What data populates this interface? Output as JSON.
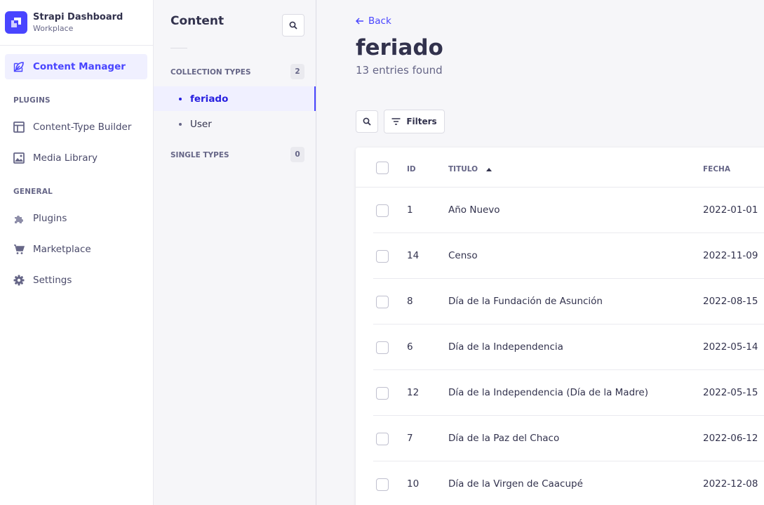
{
  "brand": {
    "name": "Strapi Dashboard",
    "workspace": "Workplace",
    "color": "#4945ff"
  },
  "mainnav": {
    "active": {
      "label": "Content Manager",
      "icon": "feather-icon"
    },
    "sections": [
      {
        "label": "PLUGINS",
        "items": [
          {
            "label": "Content-Type Builder",
            "icon": "layout-icon"
          },
          {
            "label": "Media Library",
            "icon": "image-icon"
          }
        ]
      },
      {
        "label": "GENERAL",
        "items": [
          {
            "label": "Plugins",
            "icon": "puzzle-icon"
          },
          {
            "label": "Marketplace",
            "icon": "cart-icon"
          },
          {
            "label": "Settings",
            "icon": "gear-icon"
          }
        ]
      }
    ]
  },
  "subnav": {
    "title": "Content",
    "collection_label": "COLLECTION TYPES",
    "collection_count": "2",
    "collection_items": [
      "feriado",
      "User"
    ],
    "single_label": "SINGLE TYPES",
    "single_count": "0"
  },
  "main": {
    "back_label": "Back",
    "title": "feriado",
    "subtitle": "13 entries found",
    "filters_label": "Filters"
  },
  "table": {
    "columns": {
      "id": "ID",
      "titulo": "TITULO",
      "fecha": "FECHA"
    },
    "rows": [
      {
        "id": "1",
        "titulo": "Año Nuevo",
        "fecha": "2022-01-01"
      },
      {
        "id": "14",
        "titulo": "Censo",
        "fecha": "2022-11-09"
      },
      {
        "id": "8",
        "titulo": "Día de la Fundación de Asunción",
        "fecha": "2022-08-15"
      },
      {
        "id": "6",
        "titulo": "Día de la Independencia",
        "fecha": "2022-05-14"
      },
      {
        "id": "12",
        "titulo": "Día de la Independencia (Día de la Madre)",
        "fecha": "2022-05-15"
      },
      {
        "id": "7",
        "titulo": "Día de la Paz del Chaco",
        "fecha": "2022-06-12"
      },
      {
        "id": "10",
        "titulo": "Día de la Virgen de Caacupé",
        "fecha": "2022-12-08"
      }
    ]
  },
  "colors": {
    "accent": "#4945ff",
    "active_bg": "#f0f0ff",
    "text": "#32324d",
    "muted": "#666687"
  }
}
